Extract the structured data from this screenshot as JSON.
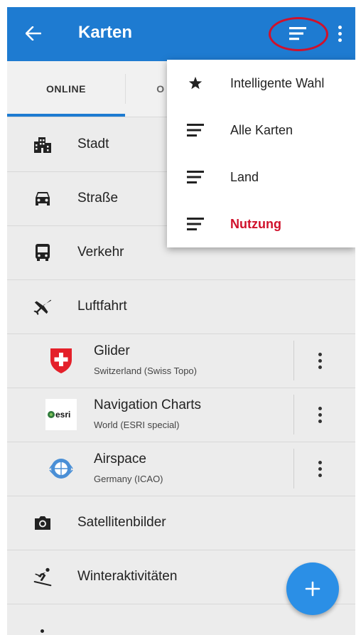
{
  "appbar": {
    "title": "Karten",
    "back_icon": "arrow-left-icon",
    "sort_icon": "sort-lines-icon",
    "more_icon": "more-vertical-icon",
    "highlight_color": "#d0112b",
    "bar_color": "#1e7bd1"
  },
  "tabs": [
    {
      "label": "ONLINE",
      "active": true
    },
    {
      "label": "O",
      "active": false
    }
  ],
  "categories": [
    {
      "label": "Stadt",
      "icon": "city-icon"
    },
    {
      "label": "Straße",
      "icon": "car-icon"
    },
    {
      "label": "Verkehr",
      "icon": "bus-icon"
    },
    {
      "label": "Luftfahrt",
      "icon": "airplane-icon"
    }
  ],
  "maps": [
    {
      "name": "Glider",
      "sub": "Switzerland (Swiss Topo)",
      "logo": "swiss-shield-logo"
    },
    {
      "name": "Navigation Charts",
      "sub": "World (ESRI special)",
      "logo": "esri-logo",
      "logo_text": "esri"
    },
    {
      "name": "Airspace",
      "sub": "Germany (ICAO)",
      "logo": "icao-logo"
    }
  ],
  "more_categories": [
    {
      "label": "Satellitenbilder",
      "icon": "camera-icon"
    },
    {
      "label": "Winteraktivitäten",
      "icon": "skier-icon"
    }
  ],
  "sort_menu": {
    "items": [
      {
        "label": "Intelligente Wahl",
        "icon": "star-icon",
        "active": false
      },
      {
        "label": "Alle Karten",
        "icon": "sort-lines-icon",
        "active": false
      },
      {
        "label": "Land",
        "icon": "sort-lines-icon",
        "active": false
      },
      {
        "label": "Nutzung",
        "icon": "sort-lines-icon",
        "active": true
      }
    ],
    "active_color": "#d0112b"
  },
  "fab": {
    "label": "+",
    "icon": "plus-icon",
    "color": "#2b8fe6"
  }
}
